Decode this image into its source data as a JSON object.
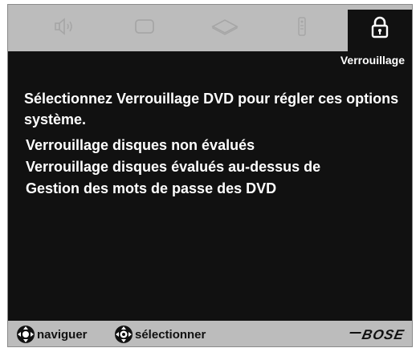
{
  "tabs": [
    {
      "name": "speaker",
      "icon": "speaker-icon"
    },
    {
      "name": "display",
      "icon": "display-icon"
    },
    {
      "name": "disc",
      "icon": "disc-icon"
    },
    {
      "name": "remote",
      "icon": "remote-icon"
    },
    {
      "name": "lock",
      "icon": "lock-icon",
      "active": true
    }
  ],
  "panel": {
    "title": "Verrouillage",
    "instruction": "Sélectionnez Verrouillage DVD pour régler ces options système.",
    "items": [
      {
        "label": "Verrouillage disques non évalués"
      },
      {
        "label": "Verrouillage disques évalués au-dessus de"
      },
      {
        "label": "Gestion des mots de passe des DVD"
      }
    ]
  },
  "footer": {
    "navigate_label": "naviguer",
    "navigate_icon": "dpad-icon",
    "select_label": "sélectionner",
    "select_icon": "dpad-select-icon",
    "brand": "BOSE"
  },
  "colors": {
    "panel_bg": "#111111",
    "frame_bg": "#bcbcbc",
    "text": "#ffffff",
    "inactive_icon": "#a8a8a8"
  }
}
